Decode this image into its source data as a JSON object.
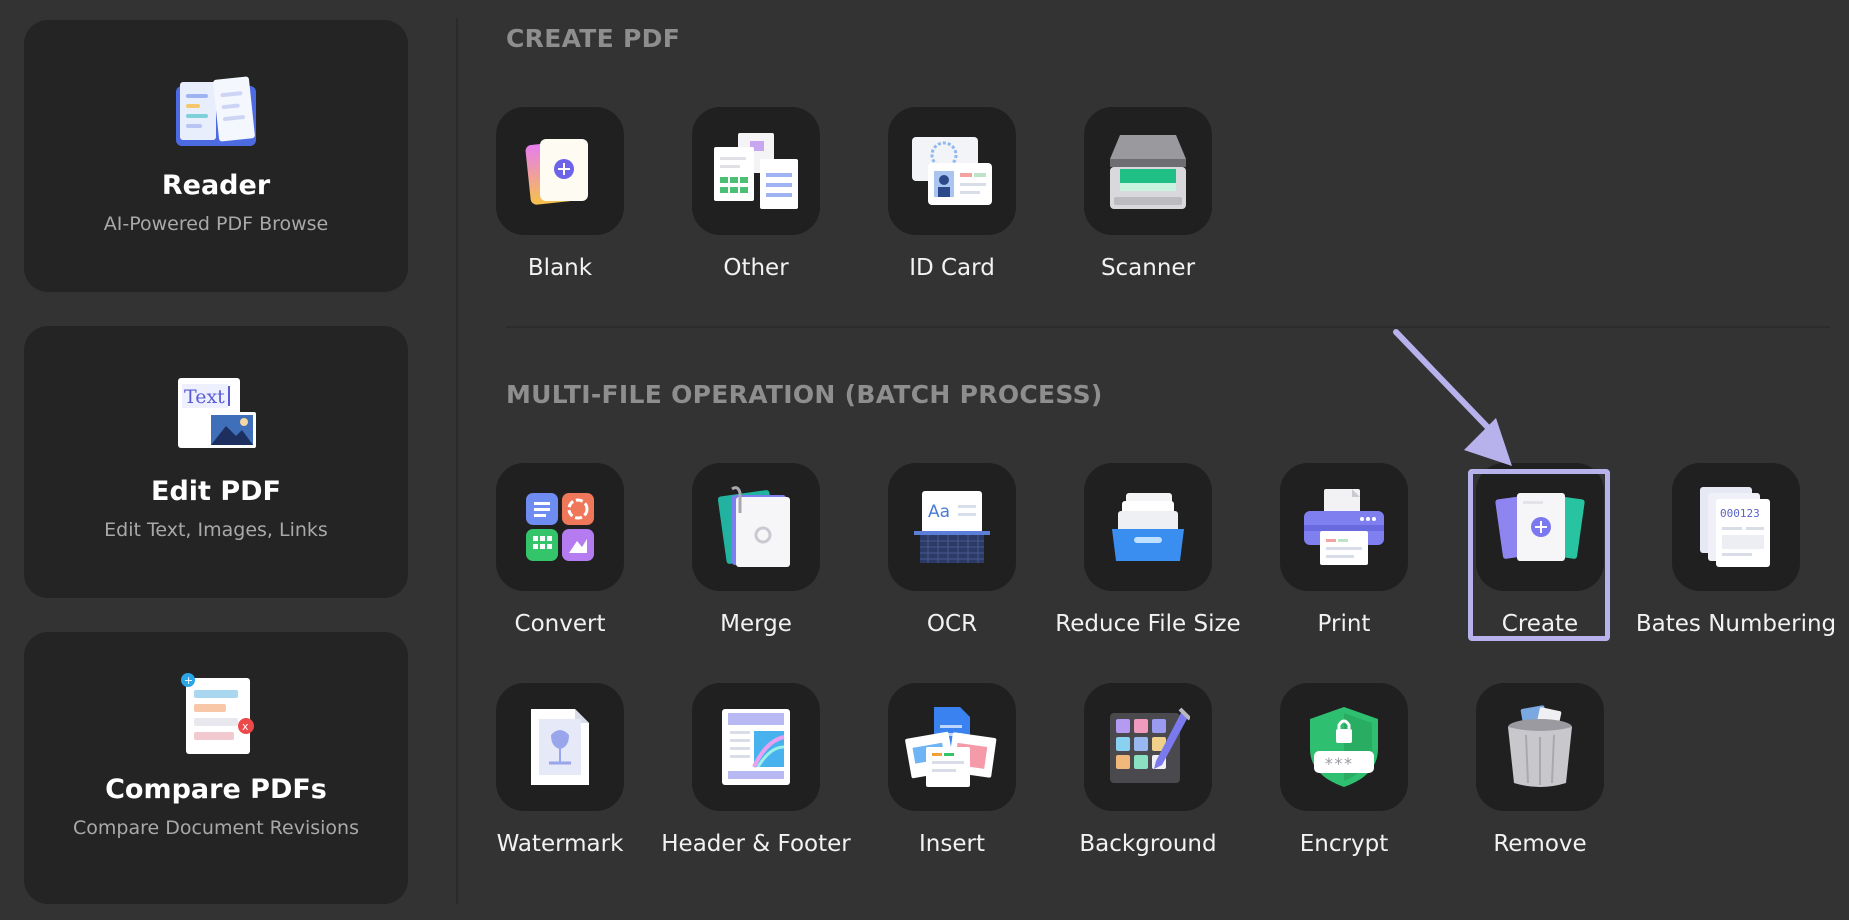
{
  "sidebar": {
    "cards": [
      {
        "title": "Reader",
        "subtitle": "AI-Powered PDF Browse",
        "icon": "reader-book-icon"
      },
      {
        "title": "Edit PDF",
        "subtitle": "Edit Text, Images, Links",
        "icon": "edit-pdf-icon",
        "icon_text": "Text"
      },
      {
        "title": "Compare PDFs",
        "subtitle": "Compare Document Revisions",
        "icon": "compare-pdfs-icon"
      }
    ]
  },
  "create_pdf": {
    "title": "CREATE PDF",
    "tools": [
      {
        "label": "Blank",
        "icon": "blank-page-icon"
      },
      {
        "label": "Other",
        "icon": "other-files-icon"
      },
      {
        "label": "ID Card",
        "icon": "id-card-icon"
      },
      {
        "label": "Scanner",
        "icon": "scanner-icon"
      }
    ]
  },
  "multi_file": {
    "title": "MULTI-FILE OPERATION (BATCH PROCESS)",
    "row1": [
      {
        "label": "Convert",
        "icon": "convert-icon"
      },
      {
        "label": "Merge",
        "icon": "merge-icon"
      },
      {
        "label": "OCR",
        "icon": "ocr-icon",
        "icon_text": "Aa"
      },
      {
        "label": "Reduce File Size",
        "icon": "reduce-file-size-icon"
      },
      {
        "label": "Print",
        "icon": "print-icon"
      },
      {
        "label": "Create",
        "icon": "create-icon",
        "highlighted": true
      },
      {
        "label": "Bates Numbering",
        "icon": "bates-numbering-icon",
        "icon_text": "000123"
      }
    ],
    "row2": [
      {
        "label": "Watermark",
        "icon": "watermark-icon"
      },
      {
        "label": "Header & Footer",
        "icon": "header-footer-icon"
      },
      {
        "label": "Insert",
        "icon": "insert-icon"
      },
      {
        "label": "Background",
        "icon": "background-icon"
      },
      {
        "label": "Encrypt",
        "icon": "encrypt-icon",
        "icon_text": "***"
      },
      {
        "label": "Remove",
        "icon": "remove-trash-icon"
      }
    ]
  },
  "colors": {
    "background": "#333333",
    "card": "#242424",
    "tile": "#202020",
    "accent": "#7b78f0",
    "highlight": "#b7b2ec"
  }
}
